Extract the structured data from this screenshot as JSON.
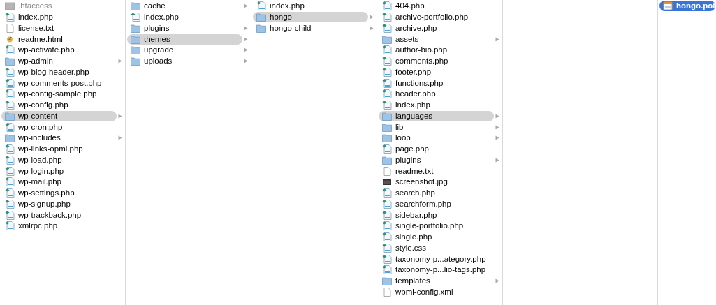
{
  "columns": [
    {
      "focused": false,
      "items": [
        {
          "name": ".htaccess",
          "kind": "hidden",
          "selected": false
        },
        {
          "name": "index.php",
          "kind": "php",
          "selected": false
        },
        {
          "name": "license.txt",
          "kind": "text",
          "selected": false
        },
        {
          "name": "readme.html",
          "kind": "html",
          "selected": false
        },
        {
          "name": "wp-activate.php",
          "kind": "php",
          "selected": false
        },
        {
          "name": "wp-admin",
          "kind": "folder",
          "selected": false
        },
        {
          "name": "wp-blog-header.php",
          "kind": "php",
          "selected": false
        },
        {
          "name": "wp-comments-post.php",
          "kind": "php",
          "selected": false
        },
        {
          "name": "wp-config-sample.php",
          "kind": "php",
          "selected": false
        },
        {
          "name": "wp-config.php",
          "kind": "php",
          "selected": false
        },
        {
          "name": "wp-content",
          "kind": "folder",
          "selected": true
        },
        {
          "name": "wp-cron.php",
          "kind": "php",
          "selected": false
        },
        {
          "name": "wp-includes",
          "kind": "folder",
          "selected": false
        },
        {
          "name": "wp-links-opml.php",
          "kind": "php",
          "selected": false
        },
        {
          "name": "wp-load.php",
          "kind": "php",
          "selected": false
        },
        {
          "name": "wp-login.php",
          "kind": "php",
          "selected": false
        },
        {
          "name": "wp-mail.php",
          "kind": "php",
          "selected": false
        },
        {
          "name": "wp-settings.php",
          "kind": "php",
          "selected": false
        },
        {
          "name": "wp-signup.php",
          "kind": "php",
          "selected": false
        },
        {
          "name": "wp-trackback.php",
          "kind": "php",
          "selected": false
        },
        {
          "name": "xmlrpc.php",
          "kind": "php",
          "selected": false
        }
      ]
    },
    {
      "focused": false,
      "items": [
        {
          "name": "cache",
          "kind": "folder",
          "selected": false
        },
        {
          "name": "index.php",
          "kind": "php",
          "selected": false
        },
        {
          "name": "plugins",
          "kind": "folder",
          "selected": false
        },
        {
          "name": "themes",
          "kind": "folder",
          "selected": true
        },
        {
          "name": "upgrade",
          "kind": "folder",
          "selected": false
        },
        {
          "name": "uploads",
          "kind": "folder",
          "selected": false
        }
      ]
    },
    {
      "focused": false,
      "items": [
        {
          "name": "index.php",
          "kind": "php",
          "selected": false
        },
        {
          "name": "hongo",
          "kind": "folder",
          "selected": true
        },
        {
          "name": "hongo-child",
          "kind": "folder",
          "selected": false
        }
      ]
    },
    {
      "focused": false,
      "items": [
        {
          "name": "404.php",
          "kind": "php",
          "selected": false
        },
        {
          "name": "archive-portfolio.php",
          "kind": "php",
          "selected": false
        },
        {
          "name": "archive.php",
          "kind": "php",
          "selected": false
        },
        {
          "name": "assets",
          "kind": "folder",
          "selected": false
        },
        {
          "name": "author-bio.php",
          "kind": "php",
          "selected": false
        },
        {
          "name": "comments.php",
          "kind": "php",
          "selected": false
        },
        {
          "name": "footer.php",
          "kind": "php",
          "selected": false
        },
        {
          "name": "functions.php",
          "kind": "php",
          "selected": false
        },
        {
          "name": "header.php",
          "kind": "php",
          "selected": false
        },
        {
          "name": "index.php",
          "kind": "php",
          "selected": false
        },
        {
          "name": "languages",
          "kind": "folder",
          "selected": true
        },
        {
          "name": "lib",
          "kind": "folder",
          "selected": false
        },
        {
          "name": "loop",
          "kind": "folder",
          "selected": false
        },
        {
          "name": "page.php",
          "kind": "php",
          "selected": false
        },
        {
          "name": "plugins",
          "kind": "folder",
          "selected": false
        },
        {
          "name": "readme.txt",
          "kind": "text",
          "selected": false
        },
        {
          "name": "screenshot.jpg",
          "kind": "image",
          "selected": false
        },
        {
          "name": "search.php",
          "kind": "php",
          "selected": false
        },
        {
          "name": "searchform.php",
          "kind": "php",
          "selected": false
        },
        {
          "name": "sidebar.php",
          "kind": "php",
          "selected": false
        },
        {
          "name": "single-portfolio.php",
          "kind": "php",
          "selected": false
        },
        {
          "name": "single.php",
          "kind": "php",
          "selected": false
        },
        {
          "name": "style.css",
          "kind": "php",
          "selected": false
        },
        {
          "name": "taxonomy-p...ategory.php",
          "kind": "php",
          "selected": false
        },
        {
          "name": "taxonomy-p...lio-tags.php",
          "kind": "php",
          "selected": false
        },
        {
          "name": "templates",
          "kind": "folder",
          "selected": false
        },
        {
          "name": "wpml-config.xml",
          "kind": "text",
          "selected": false
        }
      ]
    },
    {
      "focused": true,
      "items": [
        {
          "name": "hongo.pot",
          "kind": "pot",
          "selected": true
        }
      ]
    }
  ]
}
